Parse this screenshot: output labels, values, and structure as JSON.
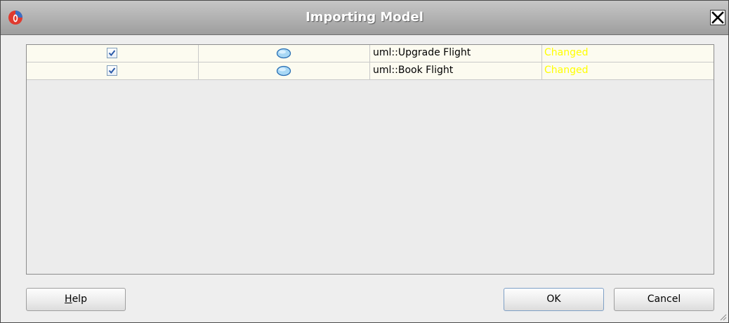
{
  "window": {
    "title": "Importing Model",
    "icons": {
      "app": "oracle-logo-icon",
      "close": "close-icon"
    }
  },
  "table": {
    "rows": [
      {
        "checked": true,
        "icon": "usecase-ellipse-icon",
        "name": "uml::Upgrade Flight",
        "status": "Changed"
      },
      {
        "checked": true,
        "icon": "usecase-ellipse-icon",
        "name": "uml::Book Flight",
        "status": "Changed"
      }
    ],
    "status_color": "#ffff00",
    "row_background": "#fcfbf0"
  },
  "buttons": {
    "help_mnemonic": "H",
    "help_rest": "elp",
    "ok": "OK",
    "cancel": "Cancel"
  }
}
